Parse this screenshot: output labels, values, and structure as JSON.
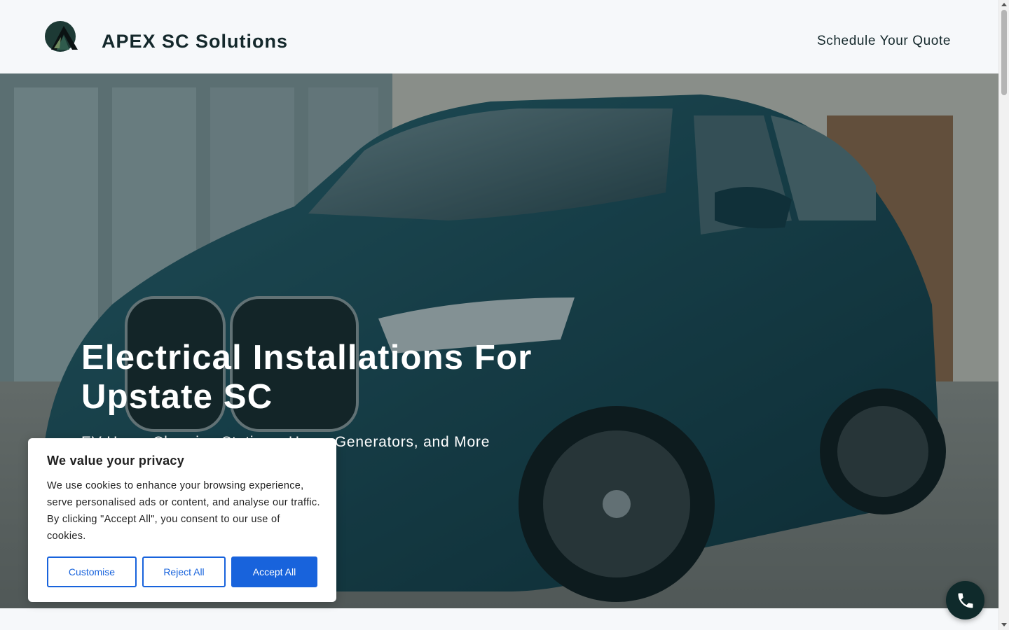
{
  "header": {
    "brand": "APEX SC Solutions",
    "nav_cta": "Schedule Your Quote",
    "logo_icon": "apex-mountain-logo"
  },
  "hero": {
    "title": "Electrical Installations For Upstate SC",
    "subtitle": "EV Home Charging Stations, Home Generators, and More",
    "background": "teal SUV parked on paver driveway"
  },
  "cookie_banner": {
    "title": "We value your privacy",
    "text": "We use cookies to enhance your browsing experience, serve personalised ads or content, and analyse our traffic. By clicking \"Accept All\", you consent to our use of cookies.",
    "customise_label": "Customise",
    "reject_label": "Reject All",
    "accept_label": "Accept All",
    "accent_color": "#1863dc"
  },
  "call_button": {
    "icon": "phone-icon",
    "color": "#0f2a2b"
  }
}
